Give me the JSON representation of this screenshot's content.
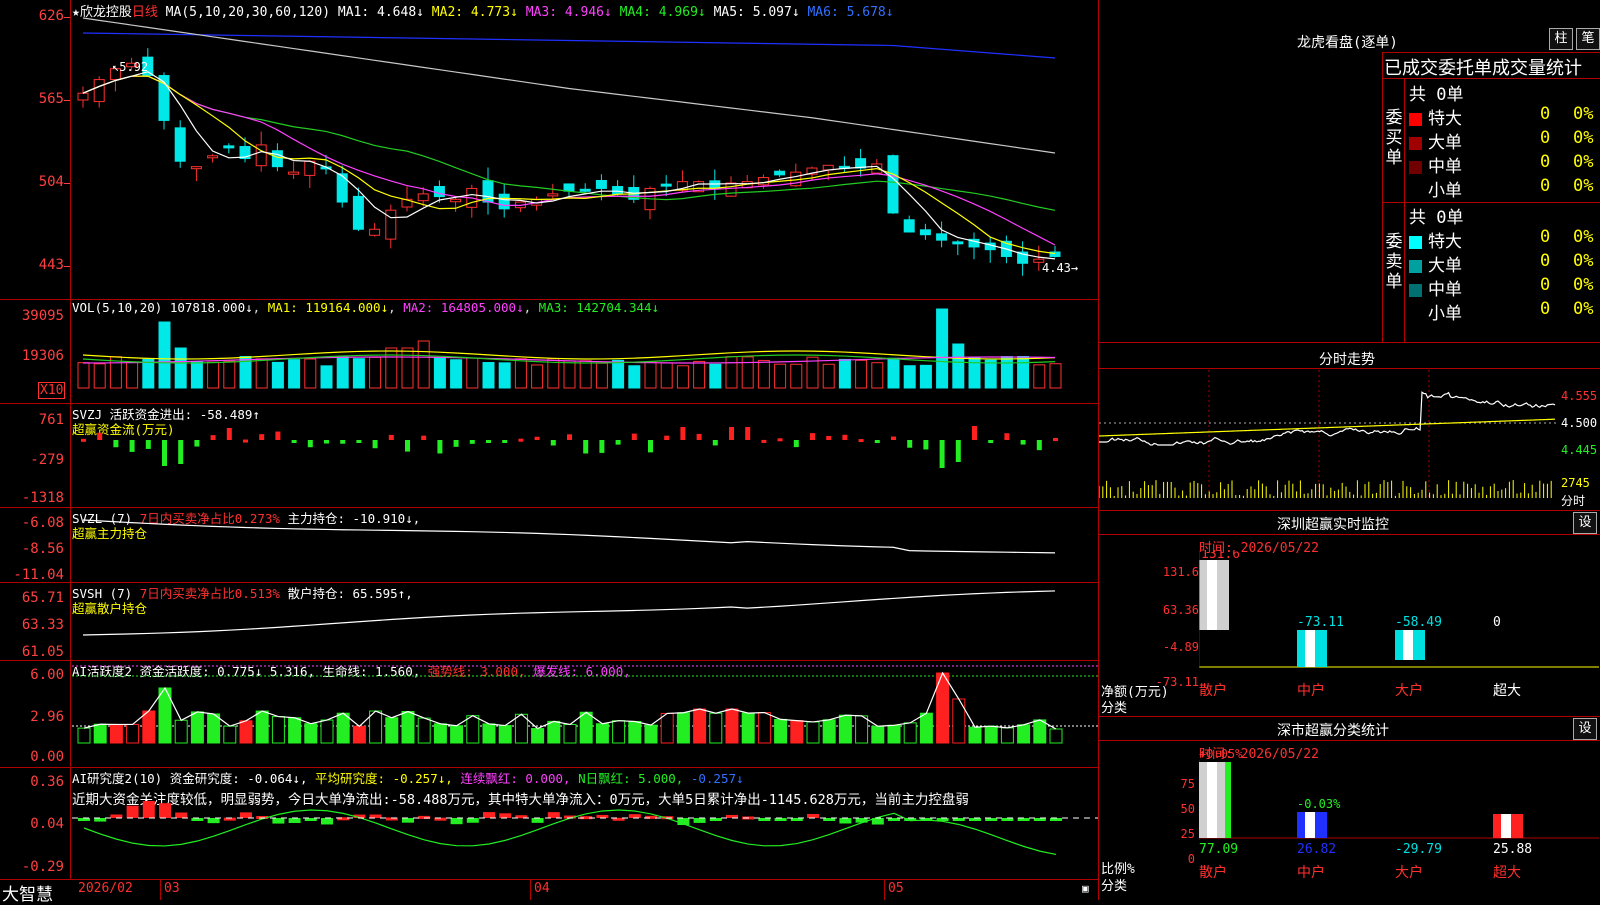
{
  "main": {
    "title": "★欣龙控股",
    "period": "日线",
    "ma_header": {
      "label": "MA(5,10,20,30,60,120)",
      "ma1": "MA1: 4.648↓",
      "ma2": "MA2: 4.773↓",
      "ma3": "MA3: 4.946↓",
      "ma4": "MA4: 4.969↓",
      "ma5": "MA5: 5.097↓",
      "ma6": "MA6: 5.678↓"
    },
    "y_labels": [
      "626",
      "565",
      "504",
      "443"
    ],
    "high_note": "5.92",
    "low_note": "4.43"
  },
  "vol": {
    "header": {
      "label": "VOL(5,10,20)",
      "val": "107818.000↓",
      "ma1": "MA1: 119164.000↓",
      "ma2": "MA2: 164805.000↓",
      "ma3": "MA3: 142704.344↓"
    },
    "y_labels": [
      "39095",
      "19306"
    ],
    "unit": "X10"
  },
  "svzj": {
    "header": {
      "label": "SVZJ",
      "name": "活跃资金进出:",
      "val": "-58.489↑"
    },
    "sub": "超赢资金流(万元)",
    "y_labels": [
      "761",
      "-279",
      "-1318"
    ]
  },
  "svzl": {
    "header": {
      "label": "SVZL (7)",
      "ratio": "7日内买卖净占比0.273%",
      "name": "主力持仓:",
      "val": "-10.910↓,"
    },
    "sub": "超赢主力持仓",
    "y_labels": [
      "-6.08",
      "-8.56",
      "-11.04"
    ]
  },
  "svsh": {
    "header": {
      "label": "SVSH (7)",
      "ratio": "7日内买卖净占比0.513%",
      "name": "散户持仓:",
      "val": "65.595↑,"
    },
    "sub": "超赢散户持仓",
    "y_labels": [
      "65.71",
      "63.33",
      "61.05"
    ]
  },
  "ai1": {
    "header": {
      "label": "AI活跃度2",
      "name": "资金活跃度:",
      "val": "0.775↓",
      "val2": "5.316,",
      "life": "生命线: 1.560,",
      "strong": "强势线: 3.000,",
      "burst": "爆发线: 6.000,"
    },
    "y_labels": [
      "6.00",
      "2.96",
      "0.00"
    ]
  },
  "ai2": {
    "header": {
      "label": "AI研究度2(10)",
      "name": "资金研究度:",
      "val": "-0.064↓,",
      "avg": "平均研究度: -0.257↓,",
      "red": "连续飘红: 0.000,",
      "nred": "N日飘红: 5.000,",
      "last": "-0.257↓"
    },
    "note": "近期大资金关注度较低，明显弱势，今日大单净流出:-58.488万元，其中特大单净流入：0万元，大单5日累计净出-1145.628万元，当前主力控盘弱",
    "y_labels": [
      "0.36",
      "0.04",
      "-0.29"
    ]
  },
  "xaxis": {
    "brand": "大智慧",
    "labels": [
      "2026/02",
      "03",
      "04",
      "05"
    ]
  },
  "right": {
    "lhb_title": "龙虎看盘(逐单)",
    "btn_bar": "柱",
    "btn_pen": "笔",
    "stat_title": "已成交委托单成交量统计",
    "buy": {
      "side": "委买单",
      "total": "共 0单",
      "rows": [
        {
          "label": "特大",
          "count": "0",
          "pct": "0%"
        },
        {
          "label": "大单",
          "count": "0",
          "pct": "0%"
        },
        {
          "label": "中单",
          "count": "0",
          "pct": "0%"
        },
        {
          "label": "小单",
          "count": "0",
          "pct": "0%"
        }
      ]
    },
    "sell": {
      "side": "委卖单",
      "total": "共 0单",
      "rows": [
        {
          "label": "特大",
          "count": "0",
          "pct": "0%"
        },
        {
          "label": "大单",
          "count": "0",
          "pct": "0%"
        },
        {
          "label": "中单",
          "count": "0",
          "pct": "0%"
        },
        {
          "label": "小单",
          "count": "0",
          "pct": "0%"
        }
      ]
    },
    "fs_title": "分时走势",
    "fs_y": [
      "4.555",
      "4.500",
      "4.445"
    ],
    "fs_vol": "2745",
    "fs_unit": "分时",
    "sz_title": "深圳超赢实时监控",
    "sz_btn": "设",
    "sz_time": "时间: 2026/05/22",
    "sz_y": [
      "131.6",
      "63.36",
      "-4.89",
      "-73.11"
    ],
    "sz_yunit": "净额(万元)",
    "sz_xunit": "分类",
    "sz_bars": [
      {
        "label": "散户",
        "value": "131.6"
      },
      {
        "label": "中户",
        "value": "-73.11"
      },
      {
        "label": "大户",
        "value": "-58.49"
      },
      {
        "label": "超大",
        "value": "0"
      }
    ],
    "sc_title": "深市超赢分类统计",
    "sc_btn": "设",
    "sc_time": "时间: 2026/05/22",
    "sc_y": [
      "75",
      "50",
      "25",
      "0"
    ],
    "sc_yunit": "比例%",
    "sc_xunit": "分类",
    "sc_top": [
      "+0.05%",
      "-0.03%"
    ],
    "sc_bars": [
      {
        "label": "散户",
        "value": "77.09"
      },
      {
        "label": "中户",
        "value": "26.82"
      },
      {
        "label": "大户",
        "value": "-29.79"
      },
      {
        "label": "超大",
        "value": "25.88"
      }
    ]
  }
}
